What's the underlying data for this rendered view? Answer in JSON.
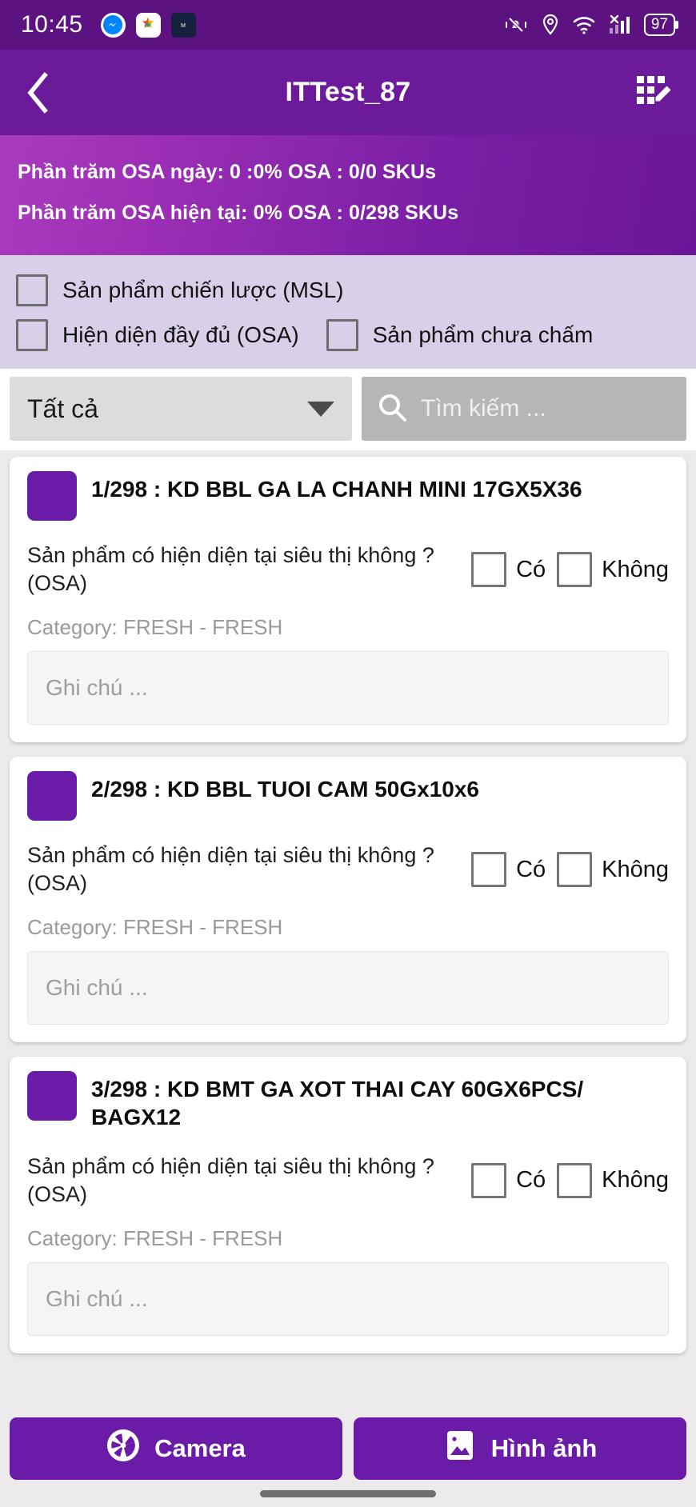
{
  "statusbar": {
    "time": "10:45",
    "battery": "97",
    "left_icons": [
      "messenger-icon",
      "app-store-icon",
      "photo-app-icon"
    ],
    "right_icons": [
      "vibrate-off-icon",
      "location-icon",
      "wifi-icon",
      "signal-no-service-icon",
      "battery-icon"
    ]
  },
  "appbar": {
    "back_icon": "chevron-left-icon",
    "title": "ITTest_87",
    "action_icon": "grid-edit-icon"
  },
  "stats": {
    "line1": "Phần trăm OSA ngày: 0 :0%  OSA : 0/0 SKUs",
    "line2": "Phần trăm OSA hiện tại: 0%  OSA : 0/298 SKUs"
  },
  "filters": [
    {
      "label": "Sản phẩm chiến lược (MSL)",
      "checked": false
    },
    {
      "label": "Hiện diện đầy đủ (OSA)",
      "checked": false
    },
    {
      "label": "Sản phẩm chưa chấm",
      "checked": false
    }
  ],
  "search": {
    "dropdown_value": "Tất cả",
    "dropdown_icon": "chevron-down-icon",
    "search_icon": "search-icon",
    "placeholder": "Tìm kiếm ..."
  },
  "products": [
    {
      "title": "1/298 : KD BBL GA LA CHANH MINI 17GX5X36",
      "question": "Sản phẩm có hiện diện tại siêu thị không ?(OSA)",
      "yes_label": "Có",
      "no_label": "Không",
      "yes_checked": false,
      "no_checked": false,
      "category": "Category: FRESH - FRESH",
      "note_placeholder": "Ghi chú ..."
    },
    {
      "title": "2/298 : KD BBL TUOI CAM 50Gx10x6",
      "question": "Sản phẩm có hiện diện tại siêu thị không ?(OSA)",
      "yes_label": "Có",
      "no_label": "Không",
      "yes_checked": false,
      "no_checked": false,
      "category": "Category: FRESH - FRESH",
      "note_placeholder": "Ghi chú ..."
    },
    {
      "title": "3/298 : KD BMT GA XOT THAI CAY 60GX6PCS/ BAGX12",
      "question": "Sản phẩm có hiện diện tại siêu thị không ?(OSA)",
      "yes_label": "Có",
      "no_label": "Không",
      "yes_checked": false,
      "no_checked": false,
      "category": "Category: FRESH - FRESH",
      "note_placeholder": "Ghi chú ..."
    }
  ],
  "bottombar": {
    "camera_label": "Camera",
    "camera_icon": "aperture-icon",
    "gallery_label": "Hình ảnh",
    "gallery_icon": "image-icon"
  },
  "colors": {
    "status_bar": "#5c1280",
    "app_bar": "#6b1b9a",
    "accent": "#6a1ba8",
    "filter_bg": "#d9cfe8",
    "page_bg": "#eceaec"
  }
}
